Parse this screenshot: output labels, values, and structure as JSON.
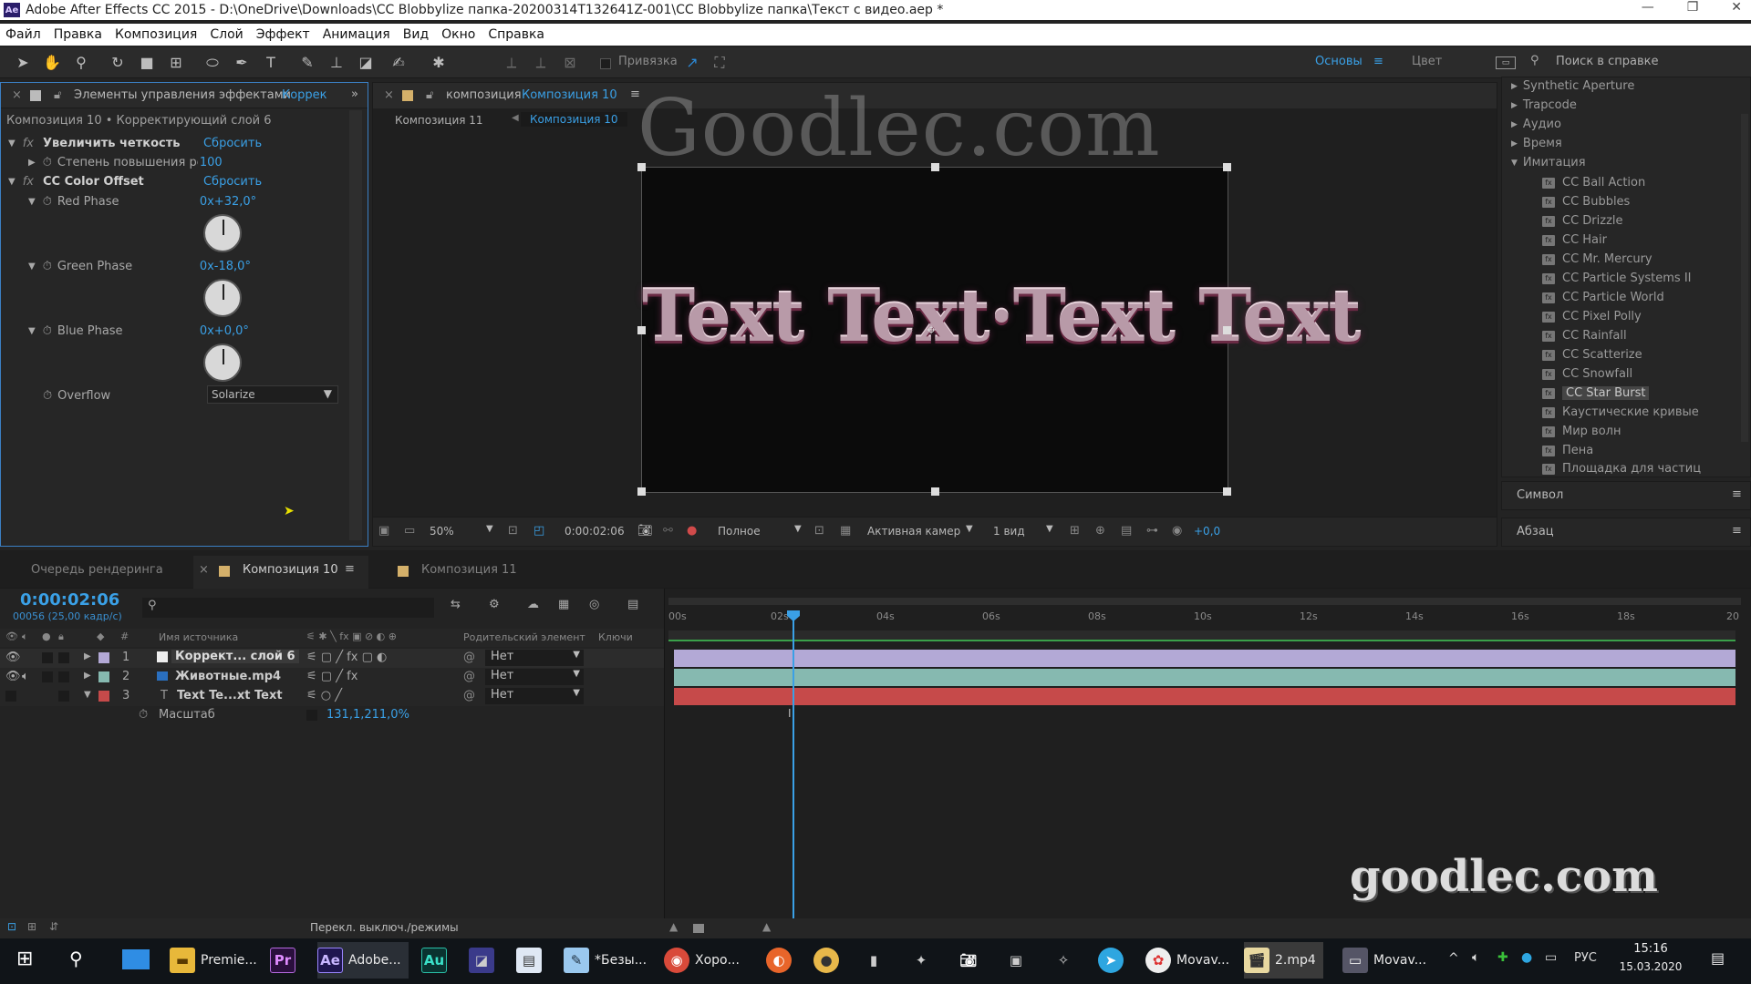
{
  "window": {
    "title": "Adobe After Effects CC 2015 - D:\\OneDrive\\Downloads\\CC Blobbylize папка-20200314T132641Z-001\\CC Blobbylize папка\\Текст с видео.aep *",
    "app_badge": "Ae"
  },
  "menu": [
    "Файл",
    "Правка",
    "Композиция",
    "Слой",
    "Эффект",
    "Анимация",
    "Вид",
    "Окно",
    "Справка"
  ],
  "toolbar": {
    "snap_label": "Привязка",
    "workspace_primary": "Основы",
    "workspace_secondary": "Цвет",
    "help_placeholder": "Поиск в справке"
  },
  "effect_controls": {
    "tab_label": "Элементы управления эффектами",
    "tab_target": "Коррек",
    "header": "Композиция 10 • Корректирующий слой 6",
    "effects": [
      {
        "name": "Увеличить четкость",
        "reset": "Сбросить",
        "param_label": "Степень повышения ре",
        "param_value": "100"
      },
      {
        "name": "CC Color Offset",
        "reset": "Сбросить"
      }
    ],
    "red_phase": {
      "label": "Red Phase",
      "value": "0x+32,0°"
    },
    "green_phase": {
      "label": "Green Phase",
      "value": "0x-18,0°"
    },
    "blue_phase": {
      "label": "Blue Phase",
      "value": "0x+0,0°"
    },
    "overflow": {
      "label": "Overflow",
      "value": "Solarize"
    }
  },
  "composition": {
    "tab_prefix": "композиция",
    "tab_name": "Композиция 10",
    "breadcrumb_1": "Композиция 11",
    "breadcrumb_2": "Композиция 10",
    "canvas_text": "Text Text·Text Text",
    "watermark_top": "Goodlec.com",
    "footer": {
      "zoom": "50%",
      "timecode": "0:00:02:06",
      "resolution": "Полное",
      "camera": "Активная камер",
      "views": "1 вид",
      "exposure": "+0,0"
    }
  },
  "effects_presets": {
    "top_items": [
      "Synthetic Aperture",
      "Trapcode",
      "Аудио",
      "Время",
      "Имитация"
    ],
    "sub_items": [
      "CC Ball Action",
      "CC Bubbles",
      "CC Drizzle",
      "CC Hair",
      "CC Mr. Mercury",
      "CC Particle Systems II",
      "CC Particle World",
      "CC Pixel Polly",
      "CC Rainfall",
      "CC Scatterize",
      "CC Snowfall",
      "CC Star Burst",
      "Каустические кривые",
      "Мир волн",
      "Пена",
      "Площадка для частиц"
    ],
    "selected": "CC Star Burst",
    "panel_symbol": "Символ",
    "panel_paragraph": "Абзац"
  },
  "timeline": {
    "tabs": [
      "Очередь рендеринга",
      "Композиция 10",
      "Композиция 11"
    ],
    "timecode": "0:00:02:06",
    "frame_info": "00056 (25,00 кадр/с)",
    "col_source": "Имя источника",
    "col_parent": "Родительский элемент",
    "col_keys": "Ключи",
    "ruler": [
      "00s",
      "02s",
      "04s",
      "06s",
      "08s",
      "10s",
      "12s",
      "14s",
      "16s",
      "18s",
      "20"
    ],
    "layers": [
      {
        "num": "1",
        "name": "Коррект... слой 6",
        "parent": "Нет",
        "color": "#b3a9d6"
      },
      {
        "num": "2",
        "name": "Животные.mp4",
        "parent": "Нет",
        "color": "#86b9b0"
      },
      {
        "num": "3",
        "name": "Text Te...xt Text",
        "parent": "Нет",
        "color": "#c64a4a"
      }
    ],
    "scale_label": "Масштаб",
    "scale_value": "131,1,211,0%",
    "footer_toggle": "Перекл. выключ./режимы",
    "watermark_bottom": "goodlec.com"
  },
  "taskbar": {
    "items": [
      "Premie...",
      "Adobe...",
      "*Безы...",
      "Хоро...",
      "Movav...",
      "2.mp4",
      "Movav..."
    ],
    "lang": "РУС",
    "time": "15:16",
    "date": "15.03.2020"
  }
}
